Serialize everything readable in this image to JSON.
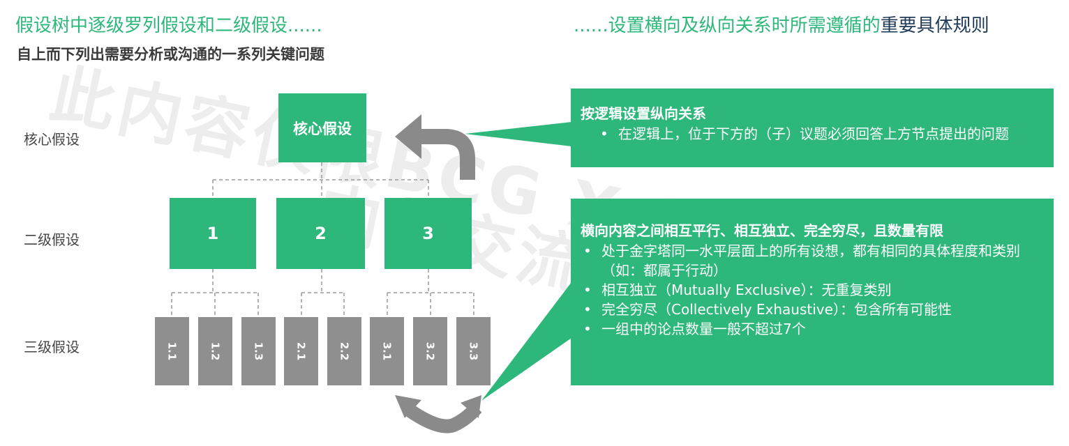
{
  "header": {
    "title_left": "假设树中逐级罗列假设和二级假设......",
    "title_right_prefix": "......设置横向及纵向关系时所需遵循的",
    "title_right_highlight": "重要具体规则",
    "subtitle": "自上而下列出需要分析或沟通的一系列关键问题"
  },
  "watermark": {
    "line1": "此内容仅限BCG X SEO X 传",
    "line2": "内部交流"
  },
  "levels": {
    "core_label": "核心假设",
    "second_label": "二级假设",
    "third_label": "三级假设"
  },
  "tree": {
    "root": "核心假设",
    "second": [
      "1",
      "2",
      "3"
    ],
    "third": [
      "1.1",
      "1.2",
      "1.3",
      "2.1",
      "2.2",
      "3.1",
      "3.2",
      "3.3"
    ]
  },
  "panel_vertical": {
    "heading": "按逻辑设置纵向关系",
    "bullets": [
      "在逻辑上，位于下方的（子）议题必须回答上方节点提出的问题"
    ]
  },
  "panel_horizontal": {
    "heading": "横向内容之间相互平行、相互独立、完全穷尽，且数量有限",
    "bullets": [
      "处于金字塔同一水平层面上的所有设想，都有相同的具体程度和类别（如：都属于行动）",
      "相互独立（Mutually Exclusive）：无重复类别",
      "完全穷尽（Collectively Exhaustive）：包含所有可能性",
      "一组中的论点数量一般不超过7个"
    ]
  },
  "colors": {
    "green": "#2db77a",
    "gray": "#8f8f8f",
    "arrow": "#8a8a8a",
    "highlight_text": "#1f3b57"
  }
}
